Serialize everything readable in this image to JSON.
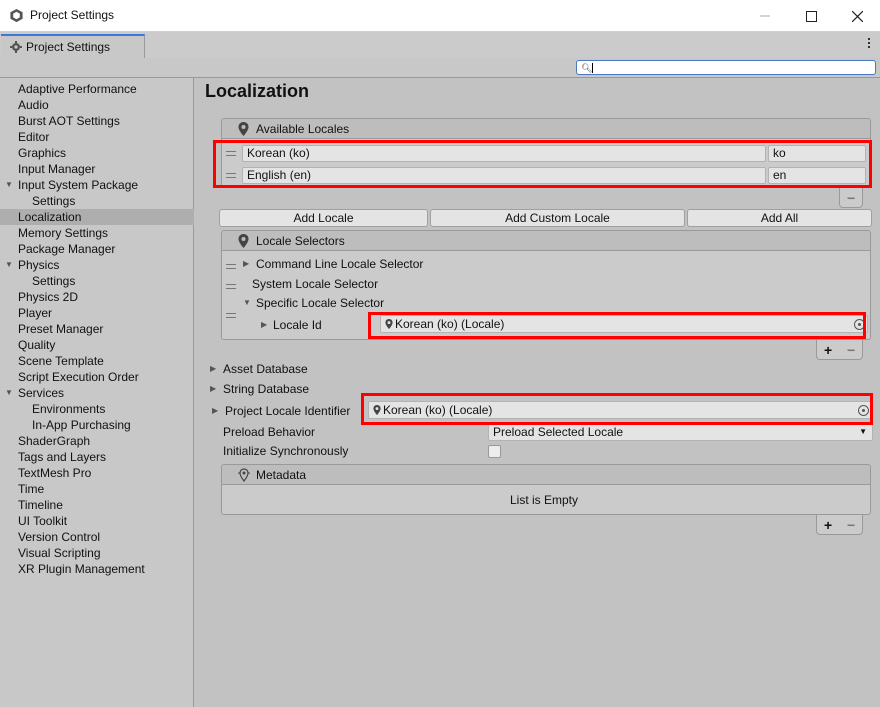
{
  "window": {
    "title": "Project Settings",
    "tab_label": "Project Settings"
  },
  "search": {
    "value": ""
  },
  "sidebar": {
    "items": [
      {
        "label": "Adaptive Performance"
      },
      {
        "label": "Audio"
      },
      {
        "label": "Burst AOT Settings"
      },
      {
        "label": "Editor"
      },
      {
        "label": "Graphics"
      },
      {
        "label": "Input Manager"
      },
      {
        "label": "Input System Package",
        "expanded": true
      },
      {
        "label": "Settings",
        "child": true
      },
      {
        "label": "Localization",
        "selected": true
      },
      {
        "label": "Memory Settings"
      },
      {
        "label": "Package Manager"
      },
      {
        "label": "Physics",
        "expanded": true
      },
      {
        "label": "Settings",
        "child": true
      },
      {
        "label": "Physics 2D"
      },
      {
        "label": "Player"
      },
      {
        "label": "Preset Manager"
      },
      {
        "label": "Quality"
      },
      {
        "label": "Scene Template"
      },
      {
        "label": "Script Execution Order"
      },
      {
        "label": "Services",
        "expanded": true
      },
      {
        "label": "Environments",
        "child": true
      },
      {
        "label": "In-App Purchasing",
        "child": true
      },
      {
        "label": "ShaderGraph"
      },
      {
        "label": "Tags and Layers"
      },
      {
        "label": "TextMesh Pro"
      },
      {
        "label": "Time"
      },
      {
        "label": "Timeline"
      },
      {
        "label": "UI Toolkit"
      },
      {
        "label": "Version Control"
      },
      {
        "label": "Visual Scripting"
      },
      {
        "label": "XR Plugin Management"
      }
    ]
  },
  "main": {
    "title": "Localization",
    "available_locales": {
      "header": "Available Locales",
      "rows": [
        {
          "name": "Korean (ko)",
          "code": "ko"
        },
        {
          "name": "English (en)",
          "code": "en"
        }
      ],
      "minus": "−"
    },
    "buttons": {
      "add_locale": "Add Locale",
      "add_custom_locale": "Add Custom Locale",
      "add_all": "Add All"
    },
    "locale_selectors": {
      "header": "Locale Selectors",
      "command_line": "Command Line Locale Selector",
      "system": "System Locale Selector",
      "specific": "Specific Locale Selector",
      "locale_id_label": "Locale Id",
      "locale_id_value": "Korean (ko) (Locale)",
      "plus": "+",
      "minus": "−"
    },
    "asset_database": "Asset Database",
    "string_database": "String Database",
    "project_locale_identifier": {
      "label": "Project Locale Identifier",
      "value": "Korean (ko) (Locale)"
    },
    "preload_behavior": {
      "label": "Preload Behavior",
      "value": "Preload Selected Locale"
    },
    "initialize_synchronously": {
      "label": "Initialize Synchronously",
      "checked": false
    },
    "metadata": {
      "header": "Metadata",
      "empty_text": "List is Empty",
      "plus": "+",
      "minus": "−"
    }
  },
  "colors": {
    "highlight": "#ff0000",
    "tab_accent": "#3a79d7",
    "selection": "#aeaeae"
  }
}
